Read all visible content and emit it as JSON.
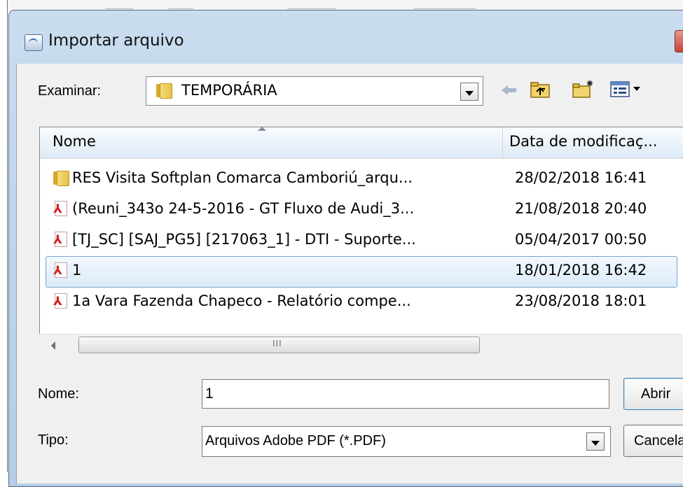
{
  "dialog": {
    "title": "Importar arquivo"
  },
  "toolbar": {
    "look_in_label": "Examinar:",
    "look_in_value": "TEMPORÁRIA"
  },
  "list": {
    "columns": {
      "name": "Nome",
      "date": "Data de modificaç..."
    },
    "rows": [
      {
        "name": "RES Visita Softplan Comarca Camboriú_arqu...",
        "date": "28/02/2018 16:41",
        "type": "folder"
      },
      {
        "name": "(Reuni_343o 24-5-2016 - GT Fluxo de Audi_3...",
        "date": "21/08/2018 20:40",
        "type": "pdf"
      },
      {
        "name": "[TJ_SC] [SAJ_PG5] [217063_1] - DTI - Suporte...",
        "date": "05/04/2017 00:50",
        "type": "pdf"
      },
      {
        "name": "1",
        "date": "18/01/2018 16:42",
        "type": "pdf",
        "selected": true
      },
      {
        "name": "1a Vara Fazenda Chapeco - Relatório compe...",
        "date": "23/08/2018 18:01",
        "type": "pdf"
      }
    ]
  },
  "form": {
    "name_label": "Nome:",
    "name_value": "1",
    "type_label": "Tipo:",
    "type_value": "Arquivos Adobe PDF (*.PDF)"
  },
  "buttons": {
    "open": "Abrir",
    "cancel": "Cancelar"
  },
  "scrollbar": {
    "grip": "III"
  }
}
